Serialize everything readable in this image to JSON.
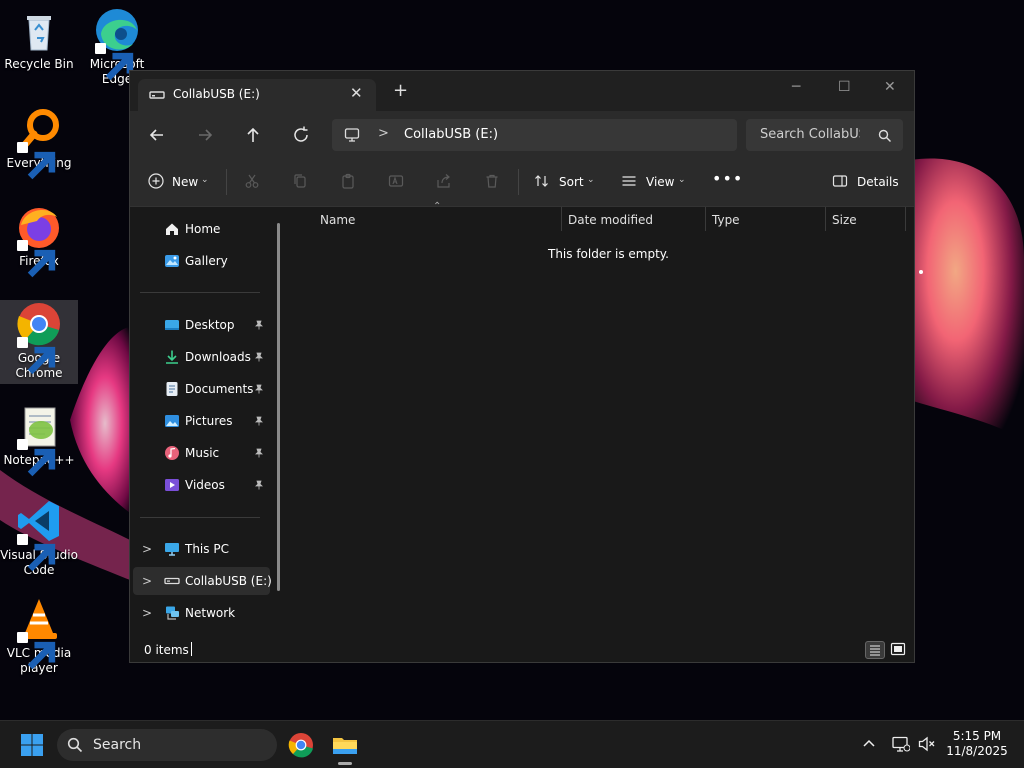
{
  "desktop": {
    "icons": [
      {
        "label": "Recycle Bin",
        "icon": "recycle-bin-icon"
      },
      {
        "label": "Microsoft Edge",
        "icon": "edge-icon"
      },
      {
        "label": "Everything",
        "icon": "everything-icon"
      },
      {
        "label": "Firefox",
        "icon": "firefox-icon"
      },
      {
        "label": "Google Chrome",
        "icon": "chrome-icon"
      },
      {
        "label": "Notepad++",
        "icon": "notepadpp-icon"
      },
      {
        "label": "Visual Studio Code",
        "icon": "vscode-icon"
      },
      {
        "label": "VLC media player",
        "icon": "vlc-icon"
      }
    ]
  },
  "explorer": {
    "tab_title": "CollabUSB (E:)",
    "address": {
      "separator": ">",
      "path": "CollabUSB (E:)"
    },
    "search_placeholder": "Search CollabUSB",
    "commands": {
      "new_label": "New",
      "sort_label": "Sort",
      "view_label": "View",
      "details_label": "Details"
    },
    "sidebar": {
      "quick": [
        {
          "label": "Home",
          "icon": "home-icon"
        },
        {
          "label": "Gallery",
          "icon": "gallery-icon"
        }
      ],
      "pinned": [
        {
          "label": "Desktop",
          "icon": "desktop-folder-icon"
        },
        {
          "label": "Downloads",
          "icon": "downloads-icon"
        },
        {
          "label": "Documents",
          "icon": "documents-icon"
        },
        {
          "label": "Pictures",
          "icon": "pictures-icon"
        },
        {
          "label": "Music",
          "icon": "music-icon"
        },
        {
          "label": "Videos",
          "icon": "videos-icon"
        }
      ],
      "locations": [
        {
          "label": "This PC",
          "icon": "this-pc-icon"
        },
        {
          "label": "CollabUSB (E:)",
          "icon": "usb-drive-icon"
        },
        {
          "label": "Network",
          "icon": "network-icon"
        }
      ]
    },
    "columns": [
      "Name",
      "Date modified",
      "Type",
      "Size"
    ],
    "empty_message": "This folder is empty.",
    "status": "0 items"
  },
  "taskbar": {
    "search_label": "Search",
    "time": "5:15 PM",
    "date": "11/8/2025"
  }
}
